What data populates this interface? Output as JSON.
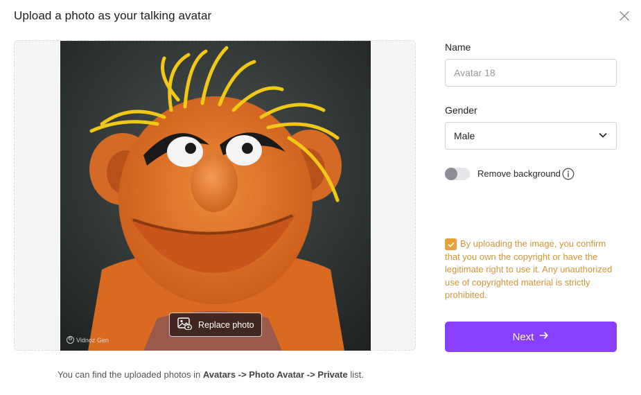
{
  "dialog": {
    "title": "Upload a photo as your talking avatar"
  },
  "upload": {
    "replace_label": "Replace photo",
    "watermark": "Vidnoz Gen",
    "hint_prefix": "You can find the uploaded photos in ",
    "hint_path_1": "Avatars",
    "hint_sep_1": " -> ",
    "hint_path_2": "Photo Avatar",
    "hint_sep_2": " -> ",
    "hint_path_3": "Private",
    "hint_suffix": " list."
  },
  "form": {
    "name_label": "Name",
    "name_placeholder": "Avatar 18",
    "name_value": "",
    "gender_label": "Gender",
    "gender_value": "Male",
    "remove_bg_label": "Remove background",
    "remove_bg_on": false,
    "consent_checked": true,
    "consent_text": "By uploading the image, you confirm that you own the copyright or have the legitimate right to use it. Any unauthorized use of copyrighted material is strictly prohibited.",
    "next_label": "Next"
  },
  "colors": {
    "accent": "#8a3ffc",
    "consent": "#d4953a",
    "checkbox": "#e6a03c"
  },
  "icons": {
    "close": "close-icon",
    "replace": "image-icon",
    "dropdown": "chevron-down-icon",
    "info": "info-icon",
    "next": "arrow-right-icon"
  }
}
